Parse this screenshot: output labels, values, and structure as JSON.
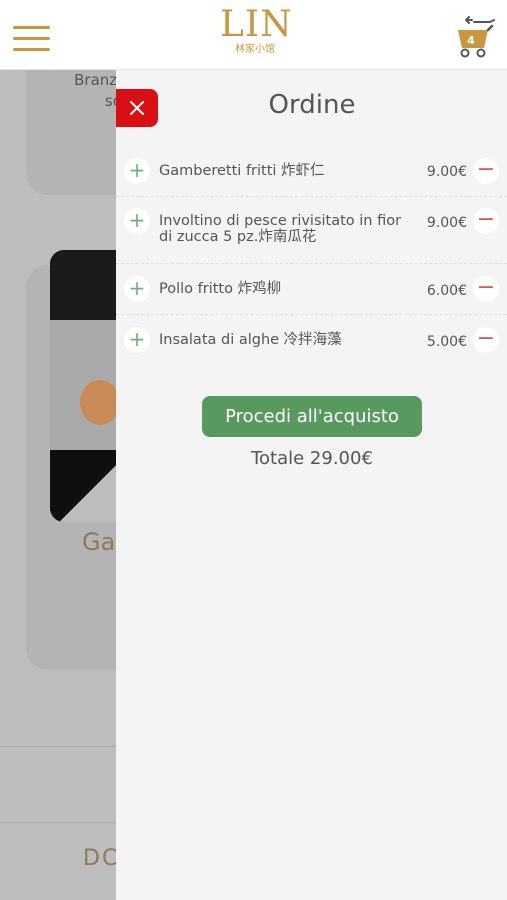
{
  "header": {
    "logo_main": "LIN",
    "logo_sub": "林家小馆",
    "cart_count": "4"
  },
  "background": {
    "card_text": "Branzino\nsoia,",
    "dish_name_partial": "Ga",
    "footer_partial": "DC"
  },
  "panel": {
    "title": "Ordine",
    "items": [
      {
        "name": "Gamberetti fritti 炸虾仁",
        "price": "9.00€"
      },
      {
        "name": "Involtino di pesce rivisitato in fior di zucca 5 pz.炸南瓜花",
        "price": "9.00€"
      },
      {
        "name": "Pollo fritto 炸鸡柳",
        "price": "6.00€"
      },
      {
        "name": "Insalata di alghe 冷拌海藻",
        "price": "5.00€"
      }
    ],
    "checkout_label": "Procedi all'acquisto",
    "total_label": "Totale 29.00€"
  },
  "colors": {
    "brand": "#c8973f",
    "close_red": "#d90f14",
    "checkout_green": "#57995e",
    "plus_green": "#6fb07a",
    "minus_red": "#e25555"
  }
}
